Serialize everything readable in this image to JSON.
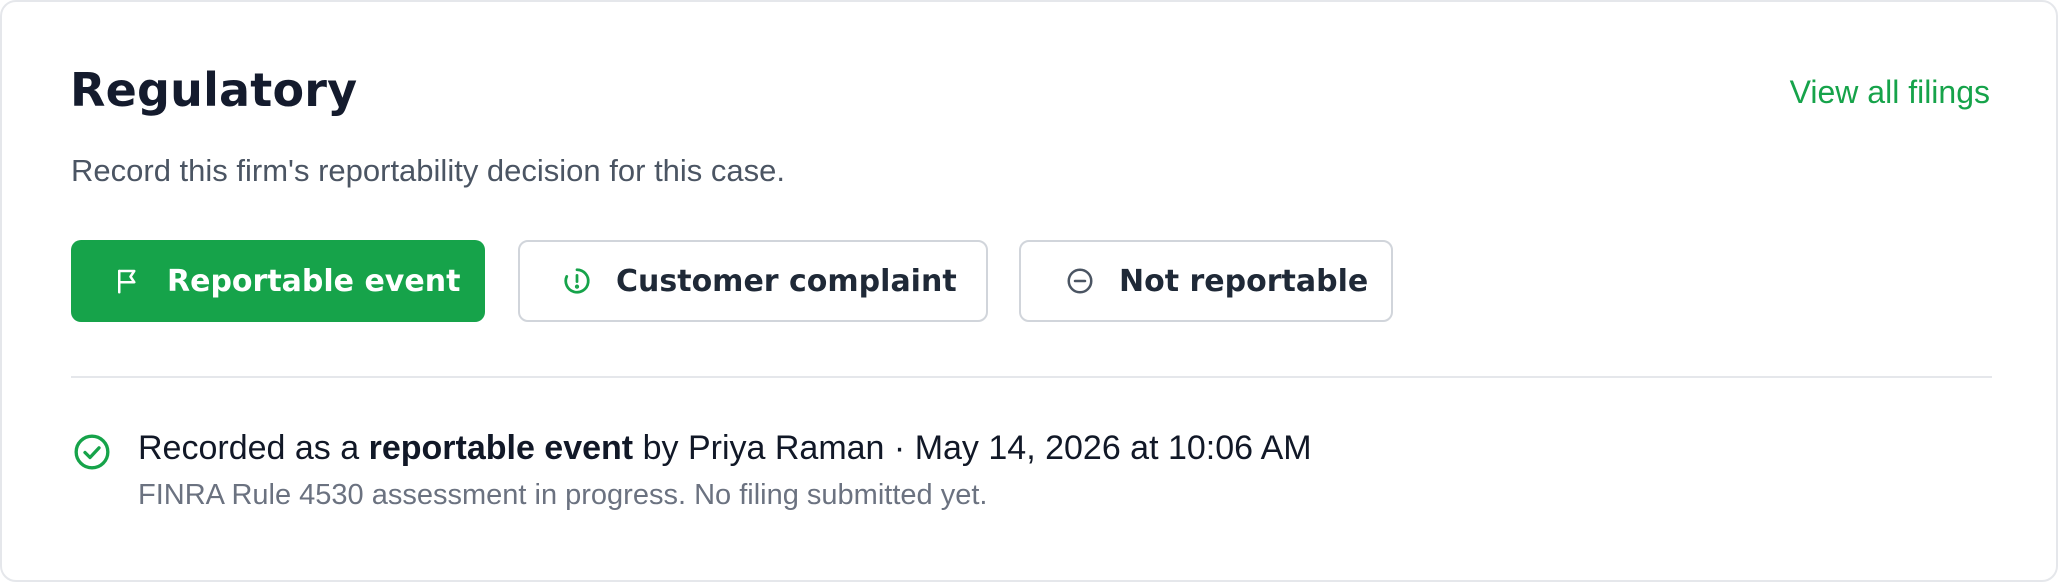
{
  "header": {
    "title": "Regulatory",
    "view_all_label": "View all filings",
    "subtitle": "Record this firm's reportability decision for this case."
  },
  "actions": [
    {
      "label": "Reportable event",
      "icon": "flag-icon",
      "selected": true
    },
    {
      "label": "Customer complaint",
      "icon": "alert-circle-icon",
      "selected": false
    },
    {
      "label": "Not reportable",
      "icon": "minus-circle-icon",
      "selected": false
    }
  ],
  "status": {
    "icon": "check-circle-icon",
    "prefix": "Recorded as a",
    "decision": "reportable event",
    "by_label": "by",
    "user": "Priya Raman",
    "separator": "·",
    "timestamp": "May 14, 2026 at 10:06 AM",
    "note": "FINRA Rule 4530 assessment in progress. No filing submitted yet."
  },
  "colors": {
    "accent": "#16a34a",
    "title": "#141b2d",
    "muted": "#6b7280",
    "border": "#d1d5db"
  }
}
